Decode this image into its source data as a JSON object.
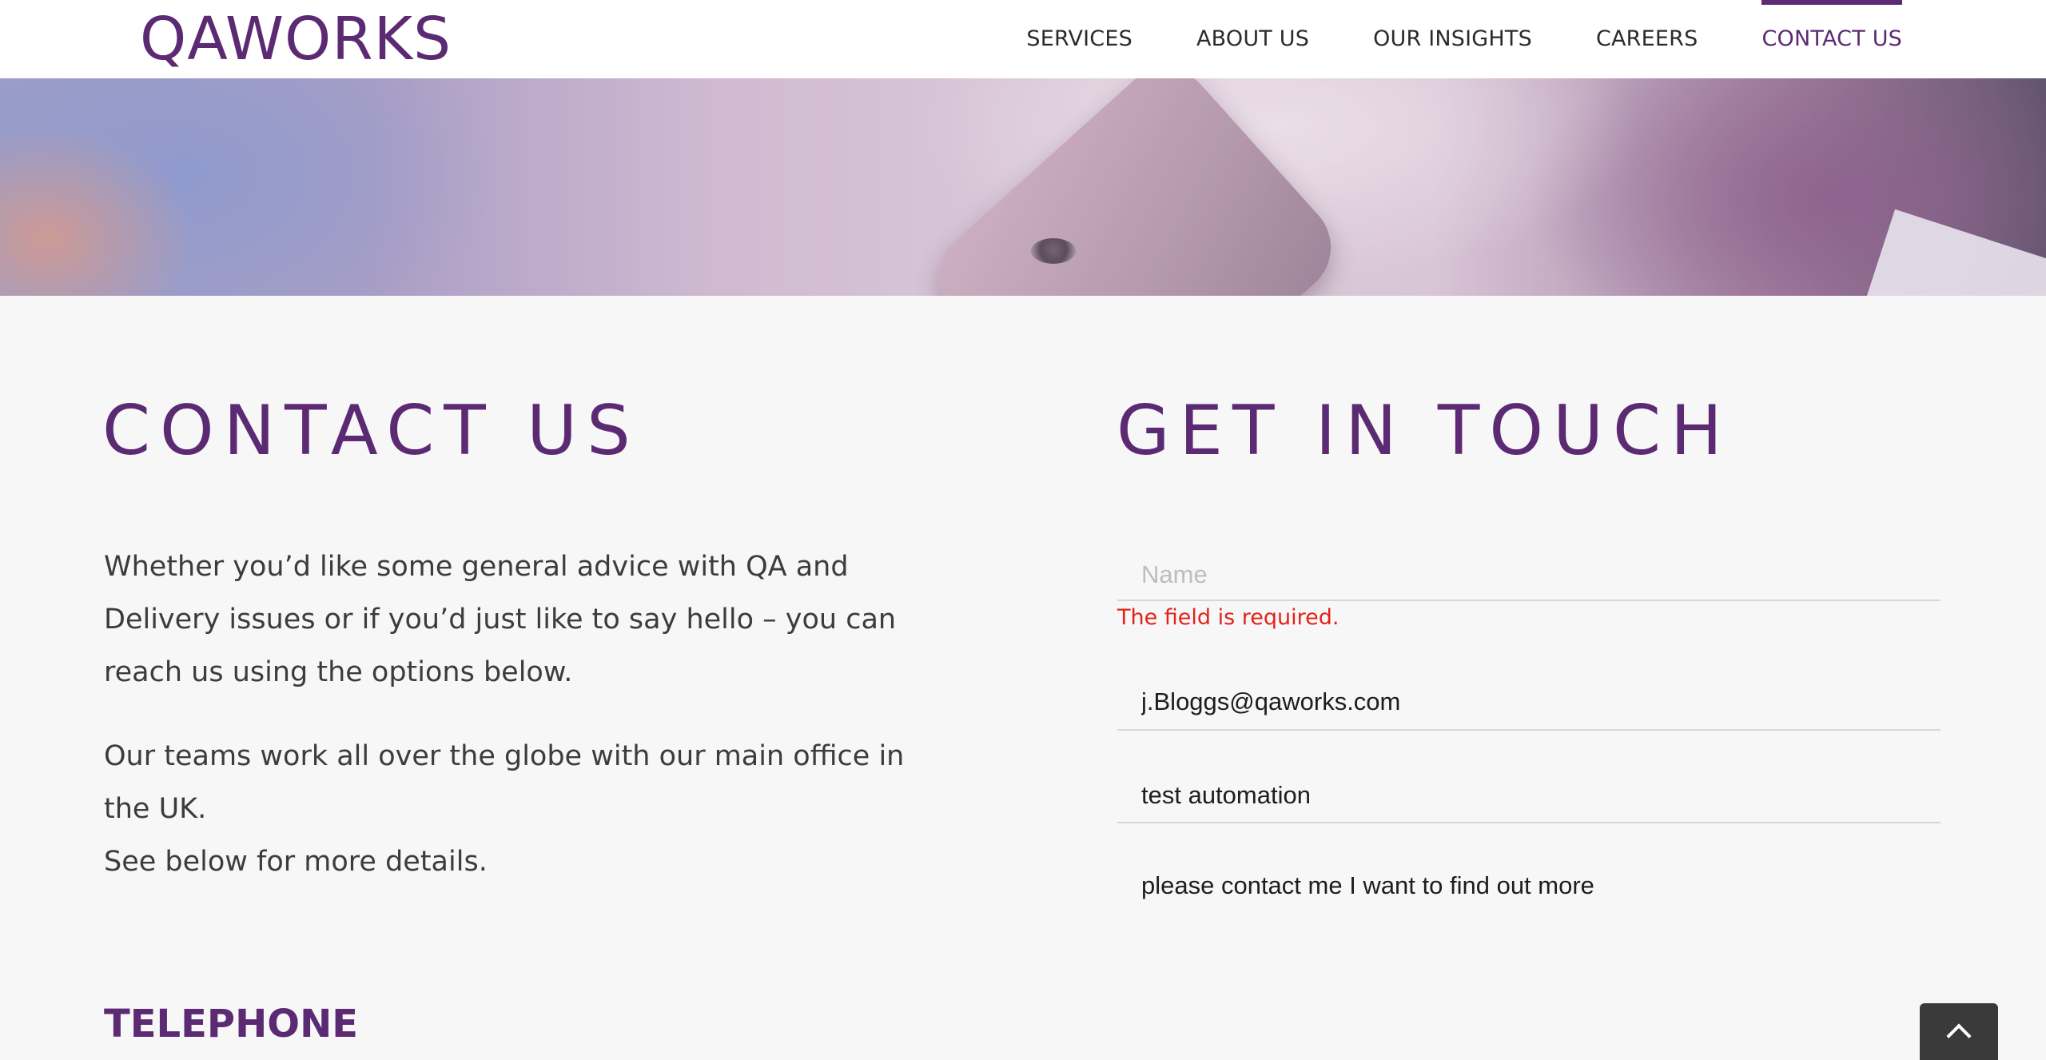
{
  "brand": {
    "logo_text": "QAWORKS",
    "accent_color": "#5b2a73",
    "error_color": "#e2231a"
  },
  "nav": {
    "items": [
      {
        "label": "SERVICES",
        "active": false
      },
      {
        "label": "ABOUT US",
        "active": false
      },
      {
        "label": "OUR INSIGHTS",
        "active": false
      },
      {
        "label": "CAREERS",
        "active": false
      },
      {
        "label": "CONTACT US",
        "active": true
      }
    ]
  },
  "contact": {
    "title": "CONTACT US",
    "paragraph_1": "Whether you’d like some general advice with QA and Delivery issues or if you’d just like to say hello – you can reach us using the options below.",
    "paragraph_2_line_1": "Our teams work all over the globe with our main office in the UK.",
    "paragraph_2_line_2": "See below for more details.",
    "telephone_heading": "TELEPHONE"
  },
  "form": {
    "title": "GET IN TOUCH",
    "name": {
      "placeholder": "Name",
      "value": ""
    },
    "name_error": "The field is required.",
    "email": {
      "value": "j.Bloggs@qaworks.com"
    },
    "subject": {
      "value": "test automation"
    },
    "message": {
      "value": "please contact me I want to find out more"
    }
  },
  "back_to_top": {
    "icon": "chevron-up-icon"
  }
}
